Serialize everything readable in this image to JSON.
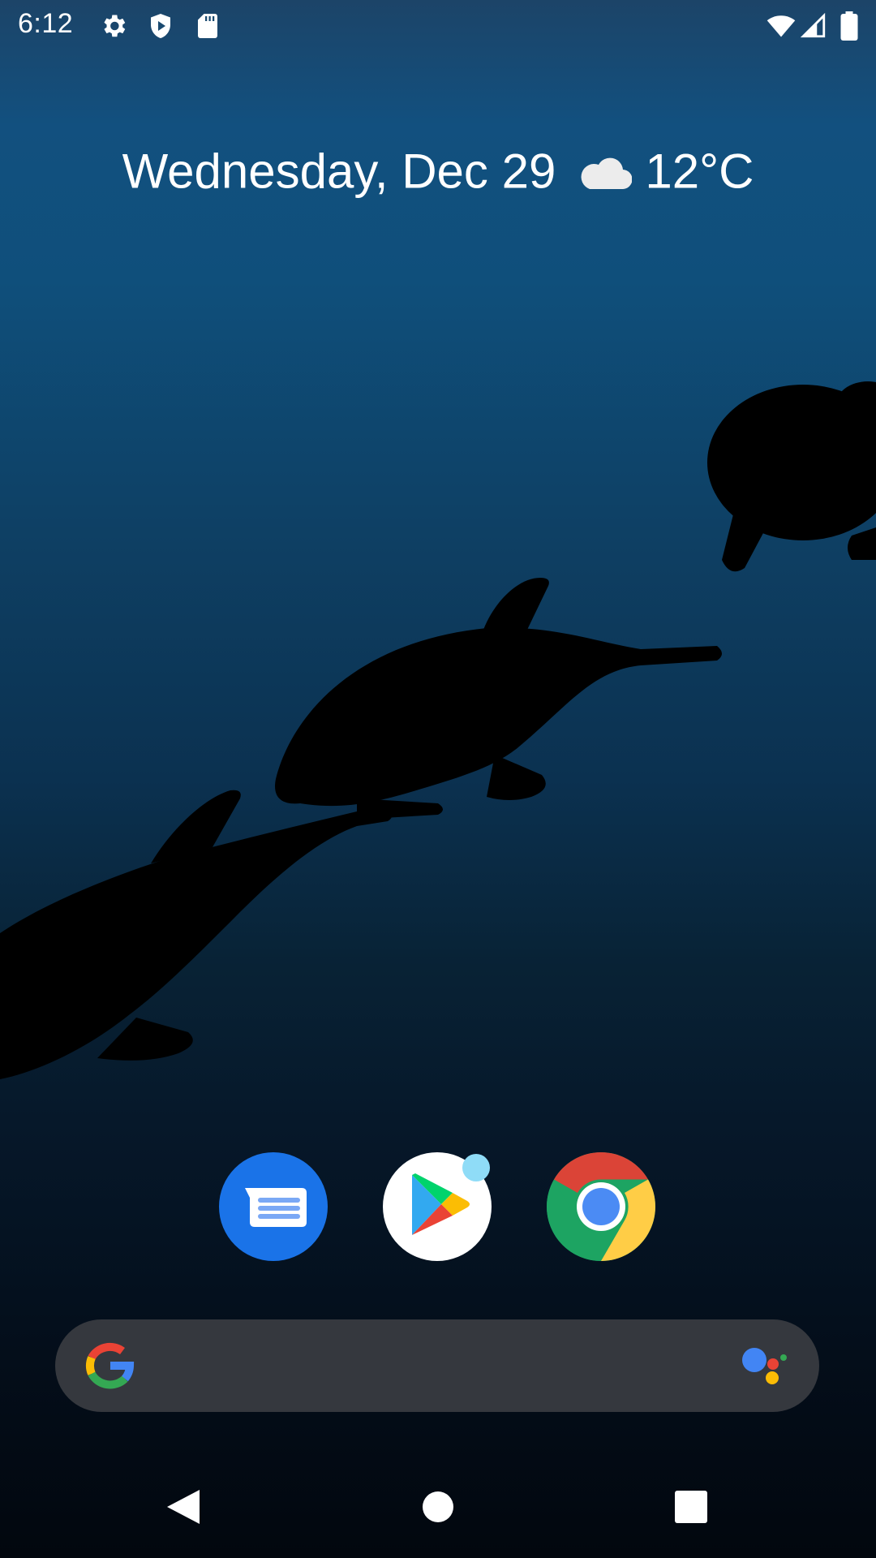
{
  "status_bar": {
    "time": "6:12",
    "icons": [
      "settings-icon",
      "shield-play-icon",
      "sd-card-icon",
      "wifi-icon",
      "cell-signal-icon",
      "battery-icon"
    ]
  },
  "glance": {
    "date": "Wednesday, Dec 29",
    "weather_icon": "cloud-icon",
    "temperature": "12°C"
  },
  "dock": {
    "apps": [
      "messages-icon",
      "play-store-icon",
      "chrome-icon"
    ],
    "notification_badge": "play-store"
  },
  "search": {
    "icons": [
      "google-g-icon",
      "google-assistant-icon"
    ]
  },
  "navigation": [
    "back-icon",
    "home-icon",
    "recents-icon"
  ],
  "colors": {
    "messages_blue": "#1a73e8",
    "search_bar_bg": "#35383e",
    "badge_dot": "#8fdcf7"
  }
}
